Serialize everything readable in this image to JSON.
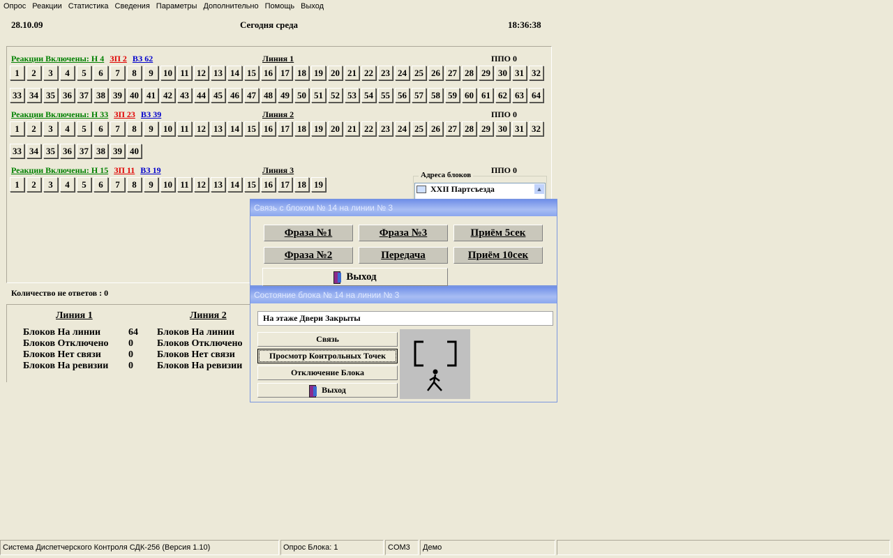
{
  "menu": [
    "Опрос",
    "Реакции",
    "Статистика",
    "Сведения",
    "Параметры",
    "Дополнительно",
    "Помощь",
    "Выход"
  ],
  "header": {
    "date": "28.10.09",
    "day_text": "Сегодня  среда",
    "time": "18:36:38"
  },
  "lines": [
    {
      "reactions_label": "Реакции Включены: Н 4",
      "zp": "ЗП  2",
      "vz": "ВЗ  62",
      "title": "Линия 1",
      "ppo": "ППО 0",
      "rows": [
        [
          "1",
          "2",
          "3",
          "4",
          "5",
          "6",
          "7",
          "8",
          "9",
          "10",
          "11",
          "12",
          "13",
          "14",
          "15",
          "16",
          "17",
          "18",
          "19",
          "20",
          "21",
          "22",
          "23",
          "24",
          "25",
          "26",
          "27",
          "28",
          "29",
          "30",
          "31",
          "32"
        ],
        [
          "33",
          "34",
          "35",
          "36",
          "37",
          "38",
          "39",
          "40",
          "41",
          "42",
          "43",
          "44",
          "45",
          "46",
          "47",
          "48",
          "49",
          "50",
          "51",
          "52",
          "53",
          "54",
          "55",
          "56",
          "57",
          "58",
          "59",
          "60",
          "61",
          "62",
          "63",
          "64"
        ]
      ]
    },
    {
      "reactions_label": "Реакции Включены: Н 33",
      "zp": "ЗП  23",
      "vz": "ВЗ  39",
      "title": "Линия 2",
      "ppo": "ППО 0",
      "rows": [
        [
          "1",
          "2",
          "3",
          "4",
          "5",
          "6",
          "7",
          "8",
          "9",
          "10",
          "11",
          "12",
          "13",
          "14",
          "15",
          "16",
          "17",
          "18",
          "19",
          "20",
          "21",
          "22",
          "23",
          "24",
          "25",
          "26",
          "27",
          "28",
          "29",
          "30",
          "31",
          "32"
        ],
        [
          "33",
          "34",
          "35",
          "36",
          "37",
          "38",
          "39",
          "40"
        ]
      ]
    },
    {
      "reactions_label": "Реакции Включены: Н 15",
      "zp": "ЗП  11",
      "vz": "ВЗ  19",
      "title": "Линия 3",
      "ppo": "ППО 0",
      "rows": [
        [
          "1",
          "2",
          "3",
          "4",
          "5",
          "6",
          "7",
          "8",
          "9",
          "10",
          "11",
          "12",
          "13",
          "14",
          "15",
          "16",
          "17",
          "18",
          "19"
        ]
      ]
    }
  ],
  "addresses": {
    "legend": "Адреса блоков",
    "items": [
      "XXII Партсъезда"
    ]
  },
  "no_answers": "Количество не ответов :  0",
  "stats": {
    "line1": {
      "title": "Линия 1",
      "rows": [
        {
          "label": "Блоков На линии",
          "value": "64"
        },
        {
          "label": "Блоков Отключено",
          "value": "0"
        },
        {
          "label": "Блоков Нет связи",
          "value": "0"
        },
        {
          "label": "Блоков На ревизии",
          "value": "0"
        }
      ]
    },
    "line2": {
      "title": "Линия 2",
      "rows": [
        {
          "label": "Блоков На линии"
        },
        {
          "label": "Блоков Отключено"
        },
        {
          "label": "Блоков Нет связи"
        },
        {
          "label": "Блоков На ревизии"
        }
      ]
    }
  },
  "dialog_comm": {
    "title": "Связь с блоком № 14 на линии № 3",
    "buttons": [
      "Фраза №1",
      "Фраза №3",
      "Приём 5сек",
      "Фраза №2",
      "Передача",
      "Приём 10сек"
    ],
    "exit": "Выход"
  },
  "dialog_state": {
    "title": "Состояние блока № 14 на линии № 3",
    "status": "На этаже Двери Закрыты",
    "buttons": [
      "Связь",
      "Просмотр Контрольных Точек",
      "Отключение Блока"
    ],
    "exit": "Выход"
  },
  "statusbar": [
    "Система Диспетчерского Контроля СДК-256 (Версия 1.10)",
    "Опрос Блока: 1",
    "COM3",
    "Демо"
  ]
}
